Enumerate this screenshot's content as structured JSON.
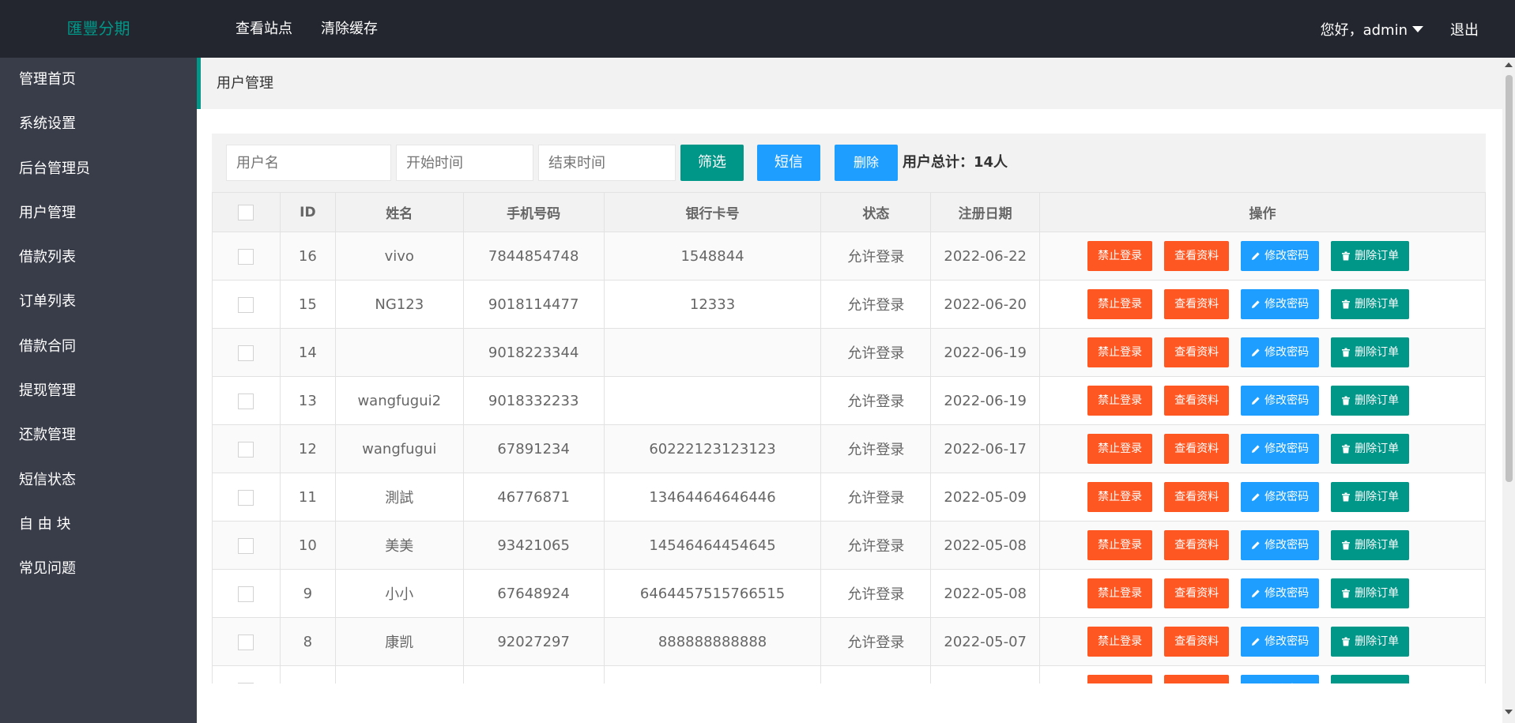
{
  "header": {
    "logo": "匯豐分期",
    "nav": [
      "查看站点",
      "清除缓存"
    ],
    "greeting": "您好，admin",
    "logout": "退出"
  },
  "sidebar": {
    "items": [
      {
        "label": "管理首页"
      },
      {
        "label": "系统设置"
      },
      {
        "label": "后台管理员"
      },
      {
        "label": "用户管理"
      },
      {
        "label": "借款列表"
      },
      {
        "label": "订单列表"
      },
      {
        "label": "借款合同"
      },
      {
        "label": "提现管理"
      },
      {
        "label": "还款管理"
      },
      {
        "label": "短信状态"
      },
      {
        "label": "自 由 块"
      },
      {
        "label": "常见问题"
      }
    ]
  },
  "breadcrumb": "用户管理",
  "filter": {
    "username_placeholder": "用户名",
    "start_placeholder": "开始时间",
    "end_placeholder": "结束时间",
    "filter_btn": "筛选",
    "sms_btn": "短信",
    "delete_btn": "删除",
    "total_label": "用户总计：14人"
  },
  "colors": {
    "green": "#009688",
    "blue": "#1e9fff",
    "red": "#ff5722",
    "header_bg": "#23262e",
    "sidebar_bg": "#393d49"
  },
  "table": {
    "columns": [
      "ID",
      "姓名",
      "手机号码",
      "银行卡号",
      "状态",
      "注册日期",
      "操作"
    ],
    "actions": {
      "ban": "禁止登录",
      "view": "查看资料",
      "password": "修改密码",
      "delete": "删除订单",
      "password_icon": "pencil-icon",
      "delete_icon": "trash-icon"
    },
    "rows": [
      {
        "id": "16",
        "name": "vivo",
        "phone": "7844854748",
        "card": "1548844",
        "status": "允许登录",
        "date": "2022-06-22"
      },
      {
        "id": "15",
        "name": "NG123",
        "phone": "9018114477",
        "card": "12333",
        "status": "允许登录",
        "date": "2022-06-20"
      },
      {
        "id": "14",
        "name": "",
        "phone": "9018223344",
        "card": "",
        "status": "允许登录",
        "date": "2022-06-19"
      },
      {
        "id": "13",
        "name": "wangfugui2",
        "phone": "9018332233",
        "card": "",
        "status": "允许登录",
        "date": "2022-06-19"
      },
      {
        "id": "12",
        "name": "wangfugui",
        "phone": "67891234",
        "card": "60222123123123",
        "status": "允许登录",
        "date": "2022-06-17"
      },
      {
        "id": "11",
        "name": "測試",
        "phone": "46776871",
        "card": "13464464646446",
        "status": "允许登录",
        "date": "2022-05-09"
      },
      {
        "id": "10",
        "name": "美美",
        "phone": "93421065",
        "card": "14546464454645",
        "status": "允许登录",
        "date": "2022-05-08"
      },
      {
        "id": "9",
        "name": "小小",
        "phone": "67648924",
        "card": "6464457515766515",
        "status": "允许登录",
        "date": "2022-05-08"
      },
      {
        "id": "8",
        "name": "康凯",
        "phone": "92027297",
        "card": "888888888888",
        "status": "允许登录",
        "date": "2022-05-07"
      },
      {
        "id": "",
        "name": "",
        "phone": "",
        "card": "",
        "status": "",
        "date": ""
      }
    ]
  }
}
